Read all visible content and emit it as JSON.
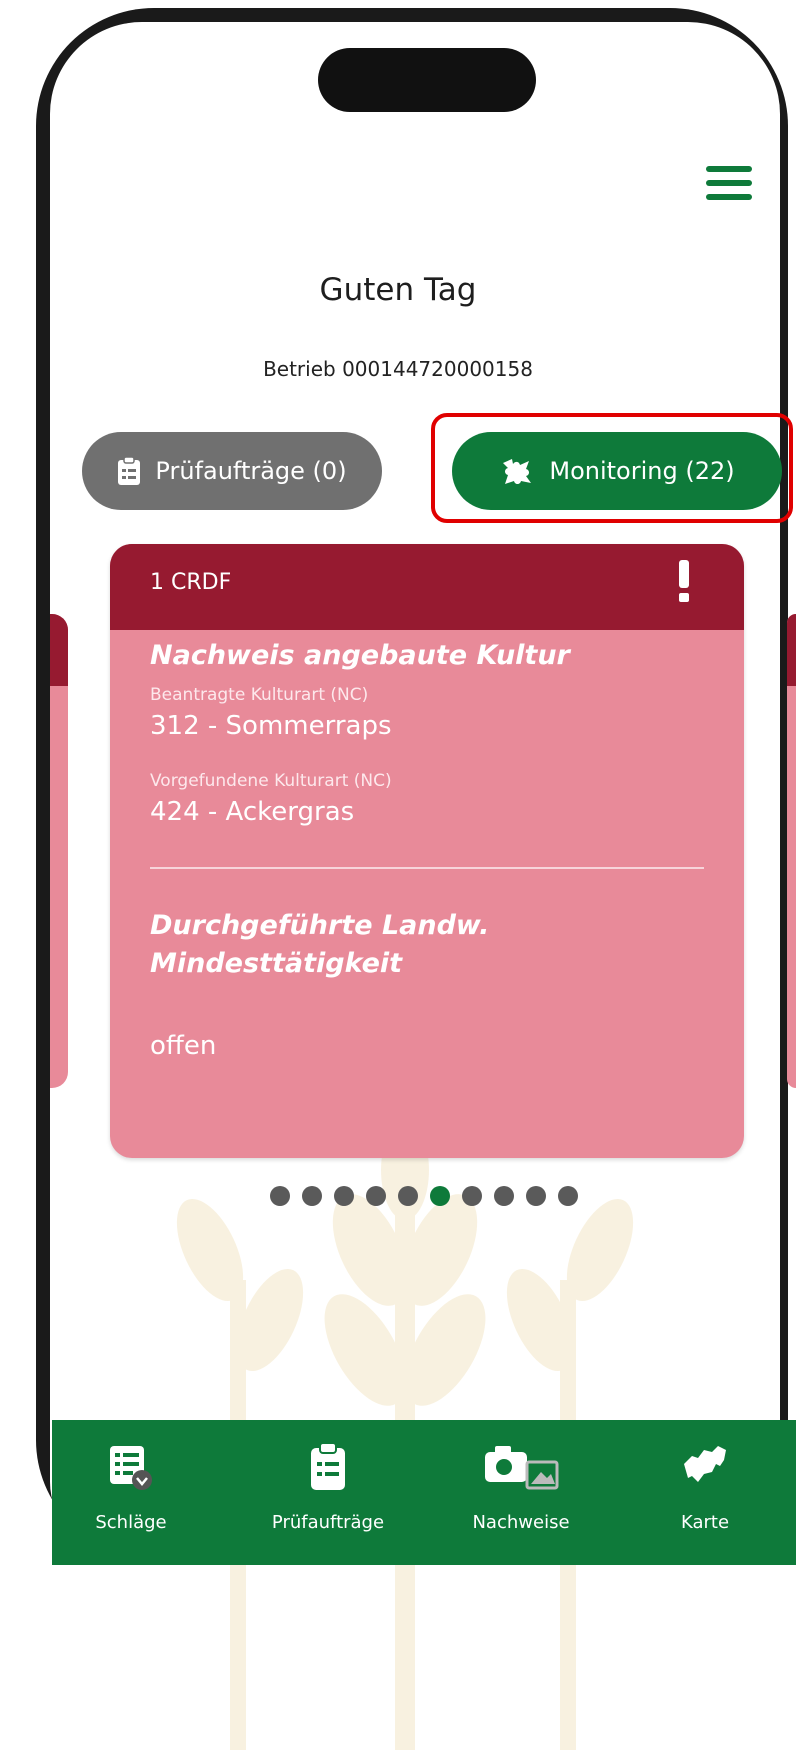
{
  "header": {
    "greeting": "Guten Tag",
    "betrieb": "Betrieb 000144720000158"
  },
  "tabs": [
    {
      "label": "Prüfaufträge (0)",
      "icon": "clipboard-icon",
      "color": "#707070"
    },
    {
      "label": "Monitoring (22)",
      "icon": "puzzle-icon",
      "color": "#0e7a3a"
    }
  ],
  "card": {
    "id": "1 CRDF",
    "alert_icon": "exclamation-icon",
    "section1_title": "Nachweis angebaute Kultur",
    "field1_label": "Beantragte Kulturart (NC)",
    "field1_value": "312 - Sommerraps",
    "field2_label": "Vorgefundene Kulturart (NC)",
    "field2_value": "424 - Ackergras",
    "section2_title_line1": "Durchgeführte Landw.",
    "section2_title_line2": "Mindesttätigkeit",
    "status": "offen",
    "header_color": "#961a30",
    "body_color": "#e88a99"
  },
  "pagination": {
    "total": 10,
    "active_index": 5
  },
  "bottom_nav": [
    {
      "label": "Schläge",
      "icon": "fields-list-icon"
    },
    {
      "label": "Prüfaufträge",
      "icon": "clipboard-icon"
    },
    {
      "label": "Nachweise",
      "icon": "camera-icon"
    },
    {
      "label": "Karte",
      "icon": "map-icon"
    }
  ],
  "colors": {
    "brand_green": "#0e7a3a",
    "highlight_red": "#e00000"
  }
}
